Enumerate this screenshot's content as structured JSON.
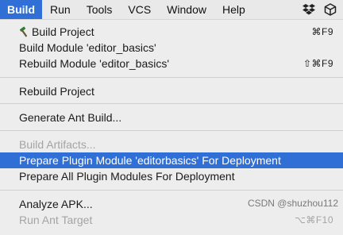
{
  "menubar": {
    "items": [
      {
        "label": "Build"
      },
      {
        "label": "Run"
      },
      {
        "label": "Tools"
      },
      {
        "label": "VCS"
      },
      {
        "label": "Window"
      },
      {
        "label": "Help"
      }
    ],
    "icons": [
      "dropbox-icon",
      "package-icon"
    ]
  },
  "menu": {
    "build_project": {
      "label": "Build Project",
      "shortcut": "⌘F9"
    },
    "build_module": {
      "label": "Build Module 'editor_basics'"
    },
    "rebuild_module": {
      "label": "Rebuild Module 'editor_basics'",
      "shortcut": "⇧⌘F9"
    },
    "rebuild_project": {
      "label": "Rebuild Project"
    },
    "generate_ant_build": {
      "label": "Generate Ant Build..."
    },
    "build_artifacts": {
      "label": "Build Artifacts..."
    },
    "prepare_plugin_module": {
      "label": "Prepare Plugin Module 'editorbasics' For Deployment"
    },
    "prepare_all_plugin_modules": {
      "label": "Prepare All Plugin Modules For Deployment"
    },
    "analyze_apk": {
      "label": "Analyze APK..."
    },
    "run_ant_target": {
      "label": "Run Ant Target",
      "shortcut": "⌥⌘F10"
    }
  },
  "watermark": "CSDN @shuzhou112",
  "colors": {
    "accent": "#2f6fd6",
    "disabled_text": "#a4a4a4",
    "menu_bg": "#ededed"
  }
}
